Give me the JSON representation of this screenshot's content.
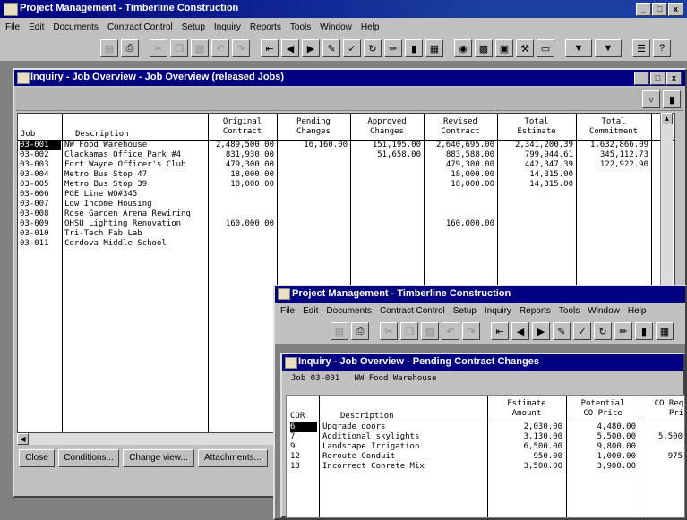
{
  "app": {
    "title": "Project Management - Timberline Construction",
    "menu": [
      "File",
      "Edit",
      "Documents",
      "Contract Control",
      "Setup",
      "Inquiry",
      "Reports",
      "Tools",
      "Window",
      "Help"
    ]
  },
  "window_controls": {
    "minimize": "_",
    "maximize": "□",
    "close": "x"
  },
  "overview": {
    "title": "Inquiry - Job Overview - Job Overview (released Jobs)",
    "headers": {
      "job": "Job",
      "description": "Description",
      "original": [
        "Original",
        "Contract"
      ],
      "pending": [
        "Pending",
        "Changes"
      ],
      "approved": [
        "Approved",
        "Changes"
      ],
      "revised": [
        "Revised",
        "Contract"
      ],
      "total_estimate": [
        "Total",
        "Estimate"
      ],
      "total_commitment": [
        "Total",
        "Commitment"
      ]
    },
    "rows": [
      {
        "job": "03-001",
        "desc": "NW Food Warehouse",
        "orig": "2,489,500.00",
        "pend": "16,160.00",
        "appr": "151,195.00",
        "rev": "2,640,695.00",
        "est": "2,341,200.39",
        "comm": "1,632,866.09"
      },
      {
        "job": "03-002",
        "desc": "Clackamas Office Park #4",
        "orig": "831,930.00",
        "pend": "",
        "appr": "51,658.00",
        "rev": "883,588.00",
        "est": "799,944.61",
        "comm": "345,112.73"
      },
      {
        "job": "03-003",
        "desc": "Fort Wayne Officer's Club",
        "orig": "479,300.00",
        "pend": "",
        "appr": "",
        "rev": "479,300.00",
        "est": "442,347.39",
        "comm": "122,922.90"
      },
      {
        "job": "03-004",
        "desc": "Metro Bus Stop 47",
        "orig": "18,000.00",
        "pend": "",
        "appr": "",
        "rev": "18,000.00",
        "est": "14,315.00",
        "comm": ""
      },
      {
        "job": "03-005",
        "desc": "Metro Bus Stop 39",
        "orig": "18,000.00",
        "pend": "",
        "appr": "",
        "rev": "18,000.00",
        "est": "14,315.00",
        "comm": ""
      },
      {
        "job": "03-006",
        "desc": "PGE Line WO#345",
        "orig": "",
        "pend": "",
        "appr": "",
        "rev": "",
        "est": "",
        "comm": ""
      },
      {
        "job": "03-007",
        "desc": "Low Income Housing",
        "orig": "",
        "pend": "",
        "appr": "",
        "rev": "",
        "est": "",
        "comm": ""
      },
      {
        "job": "03-008",
        "desc": "Rose Garden Arena Rewiring",
        "orig": "",
        "pend": "",
        "appr": "",
        "rev": "",
        "est": "",
        "comm": ""
      },
      {
        "job": "03-009",
        "desc": "OHSU Lighting Renovation",
        "orig": "160,000.00",
        "pend": "",
        "appr": "",
        "rev": "160,000.00",
        "est": "",
        "comm": ""
      },
      {
        "job": "03-010",
        "desc": "Tri-Tech Fab Lab",
        "orig": "",
        "pend": "",
        "appr": "",
        "rev": "",
        "est": "",
        "comm": ""
      },
      {
        "job": "03-011",
        "desc": "Cordova Middle School",
        "orig": "",
        "pend": "",
        "appr": "",
        "rev": "",
        "est": "",
        "comm": ""
      }
    ],
    "buttons": {
      "close": "Close",
      "conditions": "Conditions...",
      "change_view": "Change view...",
      "attachments": "Attachments..."
    }
  },
  "pending": {
    "title": "Inquiry - Job Overview - Pending Contract Changes",
    "job_label": "Job 03-001   NW Food Warehouse",
    "headers": {
      "cor": "COR",
      "description": "Description",
      "estimate": [
        "Estimate",
        "Amount"
      ],
      "potential": [
        "Potential",
        "CO Price"
      ],
      "requested": [
        "CO Reque",
        "Price"
      ]
    },
    "rows": [
      {
        "cor": "6",
        "desc": "Upgrade doors",
        "est": "2,030.00",
        "pot": "4,480.00",
        "req": ""
      },
      {
        "cor": "7",
        "desc": "Additional skylights",
        "est": "3,130.00",
        "pot": "5,500.00",
        "req": "5,500"
      },
      {
        "cor": "9",
        "desc": "Landscape Irrigation",
        "est": "6,500.00",
        "pot": "9,800.00",
        "req": ""
      },
      {
        "cor": "12",
        "desc": "Reroute Conduit",
        "est": "950.00",
        "pot": "1,000.00",
        "req": "975"
      },
      {
        "cor": "13",
        "desc": "Incorrect Conrete Mix",
        "est": "3,500.00",
        "pot": "3,900.00",
        "req": ""
      }
    ]
  },
  "colors": {
    "titlebar": "#000080",
    "face": "#c0c0c0",
    "grid_bg": "#ffffff",
    "selection": "#000000"
  }
}
